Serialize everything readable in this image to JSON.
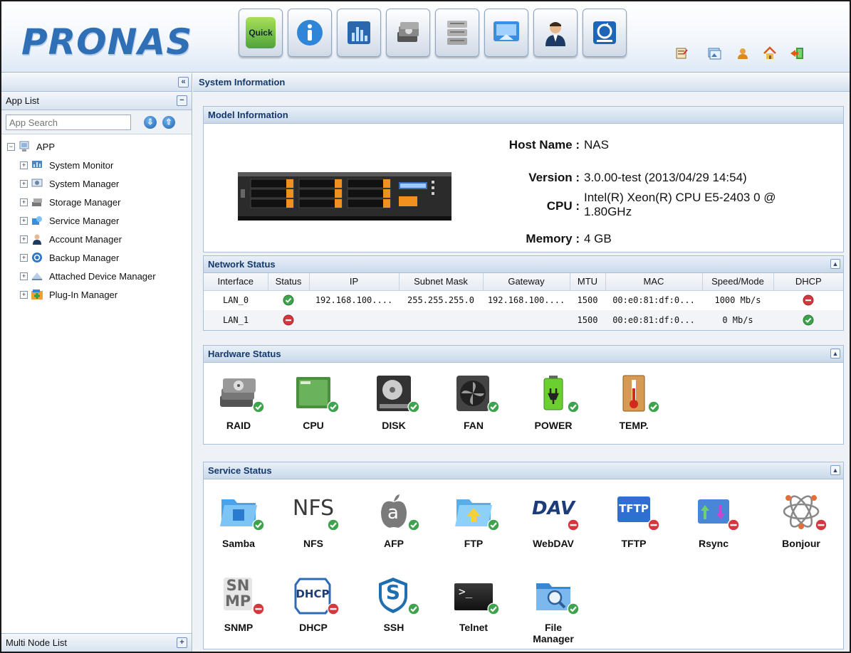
{
  "app": {
    "logo": "PRONAS"
  },
  "toolbar": {
    "quick_label": "Quick",
    "buttons": [
      "quick-wizard",
      "info",
      "system-monitor",
      "storage",
      "database",
      "network",
      "account",
      "backup"
    ]
  },
  "sidebar": {
    "app_list_label": "App List",
    "search_placeholder": "App Search",
    "root_label": "APP",
    "items": [
      {
        "label": "System Monitor"
      },
      {
        "label": "System Manager"
      },
      {
        "label": "Storage Manager"
      },
      {
        "label": "Service Manager"
      },
      {
        "label": "Account Manager"
      },
      {
        "label": "Backup Manager"
      },
      {
        "label": "Attached Device Manager"
      },
      {
        "label": "Plug-In Manager"
      }
    ],
    "multi_node_label": "Multi Node List"
  },
  "main": {
    "title": "System Information"
  },
  "model": {
    "title": "Model Information",
    "host_label": "Host Name",
    "host_value": "NAS",
    "version_label": "Version",
    "version_value": "3.0.00-test (2013/04/29 14:54)",
    "cpu_label": "CPU",
    "cpu_value_line1": "Intel(R) Xeon(R) CPU E5-2403 0 @",
    "cpu_value_line2": "1.80GHz",
    "memory_label": "Memory",
    "memory_value": "4 GB"
  },
  "network": {
    "title": "Network Status",
    "columns": [
      "Interface",
      "Status",
      "IP",
      "Subnet Mask",
      "Gateway",
      "MTU",
      "MAC",
      "Speed/Mode",
      "DHCP"
    ],
    "rows": [
      {
        "interface": "LAN_0",
        "status": "ok",
        "ip": "192.168.100....",
        "mask": "255.255.255.0",
        "gateway": "192.168.100....",
        "mtu": "1500",
        "mac": "00:e0:81:df:0...",
        "speed": "1000 Mb/s",
        "dhcp": "off"
      },
      {
        "interface": "LAN_1",
        "status": "off",
        "ip": "",
        "mask": "",
        "gateway": "",
        "mtu": "1500",
        "mac": "00:e0:81:df:0...",
        "speed": "0 Mb/s",
        "dhcp": "ok"
      }
    ]
  },
  "hardware": {
    "title": "Hardware Status",
    "items": [
      {
        "label": "RAID",
        "icon": "raid-icon",
        "status": "ok"
      },
      {
        "label": "CPU",
        "icon": "cpu-icon",
        "status": "ok"
      },
      {
        "label": "DISK",
        "icon": "disk-icon",
        "status": "ok"
      },
      {
        "label": "FAN",
        "icon": "fan-icon",
        "status": "ok"
      },
      {
        "label": "POWER",
        "icon": "power-icon",
        "status": "ok"
      },
      {
        "label": "TEMP.",
        "icon": "temperature-icon",
        "status": "ok"
      }
    ]
  },
  "service": {
    "title": "Service Status",
    "items": [
      {
        "label": "Samba",
        "icon": "samba-icon",
        "status": "ok"
      },
      {
        "label": "NFS",
        "icon": "nfs-icon",
        "status": "ok",
        "glyph": "NFS"
      },
      {
        "label": "AFP",
        "icon": "afp-icon",
        "status": "ok",
        "glyph": "a"
      },
      {
        "label": "FTP",
        "icon": "ftp-icon",
        "status": "ok"
      },
      {
        "label": "WebDAV",
        "icon": "webdav-icon",
        "status": "off",
        "glyph": "DAV"
      },
      {
        "label": "TFTP",
        "icon": "tftp-icon",
        "status": "off",
        "glyph": "TFTP"
      },
      {
        "label": "Rsync",
        "icon": "rsync-icon",
        "status": "off"
      },
      {
        "label": "Bonjour",
        "icon": "bonjour-icon",
        "status": "off"
      },
      {
        "label": "SNMP",
        "icon": "snmp-icon",
        "status": "off",
        "glyph1": "SN",
        "glyph2": "MP"
      },
      {
        "label": "DHCP",
        "icon": "dhcp-icon",
        "status": "off",
        "glyph": "DHCP"
      },
      {
        "label": "SSH",
        "icon": "ssh-icon",
        "status": "ok",
        "glyph": "S"
      },
      {
        "label": "Telnet",
        "icon": "telnet-icon",
        "status": "ok",
        "glyph": ">_"
      },
      {
        "label": "File\nManager",
        "icon": "file-manager-icon",
        "status": "ok"
      }
    ]
  },
  "colors": {
    "ok": "#3fa34d",
    "off": "#d4383e",
    "brand": "#2e6fb5",
    "header_text": "#14396b"
  }
}
